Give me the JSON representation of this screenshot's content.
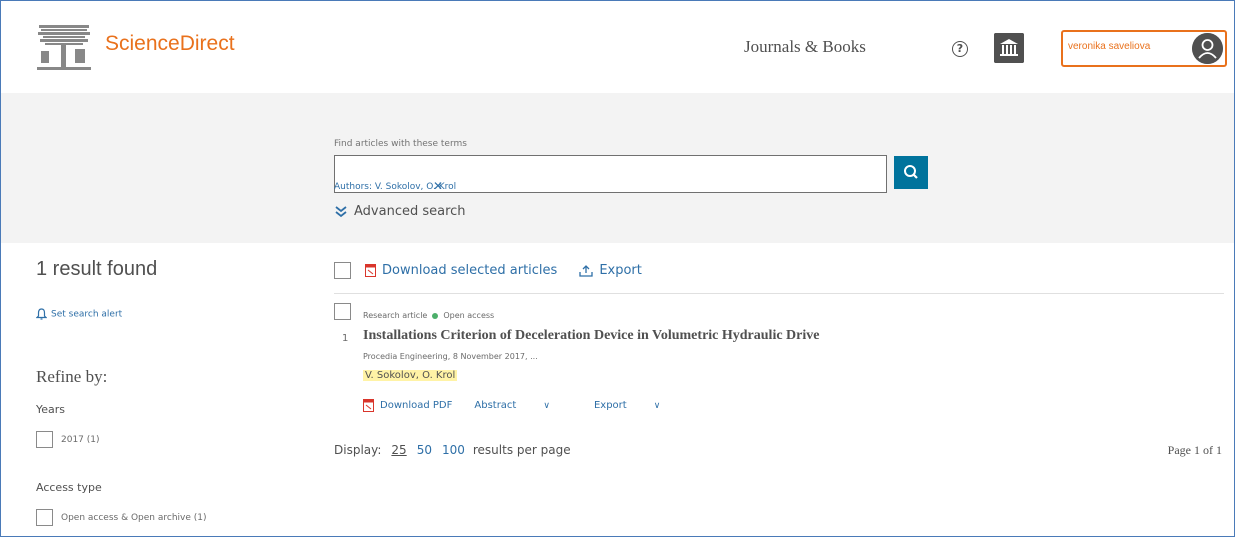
{
  "header": {
    "brand": "ScienceDirect",
    "nav_link": "Journals & Books",
    "help_symbol": "?",
    "user_name": "veronika saveliova",
    "accent_color": "#e9711c"
  },
  "search": {
    "label": "Find articles with these terms",
    "query": "",
    "chip": "Authors: V. Sokolov, O. Krol",
    "chip_remove": "✕",
    "advanced_label": "Advanced search"
  },
  "sidebar": {
    "result_count": "1 result found",
    "alert_label": "Set search alert",
    "refine_title": "Refine by:",
    "facets": [
      {
        "title": "Years",
        "option": "2017 (1)"
      },
      {
        "title": "Access type",
        "option": "Open access & Open archive (1)"
      }
    ]
  },
  "toolbar": {
    "download_label": "Download selected articles",
    "export_label": "Export"
  },
  "results": [
    {
      "index": "1",
      "type": "Research article",
      "access": "Open access",
      "title": "Installations Criterion of Deceleration Device in Volumetric Hydraulic Drive",
      "source": "Procedia Engineering, 8 November 2017, ...",
      "authors": "V. Sokolov, O. Krol",
      "actions": {
        "pdf": "Download PDF",
        "abstract": "Abstract",
        "export": "Export"
      }
    }
  ],
  "pagination": {
    "display_label": "Display:",
    "options": [
      "25",
      "50",
      "100"
    ],
    "suffix": "results per page",
    "page_label": "Page 1 of 1"
  },
  "colors": {
    "link": "#2e6fa7",
    "search_button": "#00739c",
    "band": "#f3f3f3"
  }
}
